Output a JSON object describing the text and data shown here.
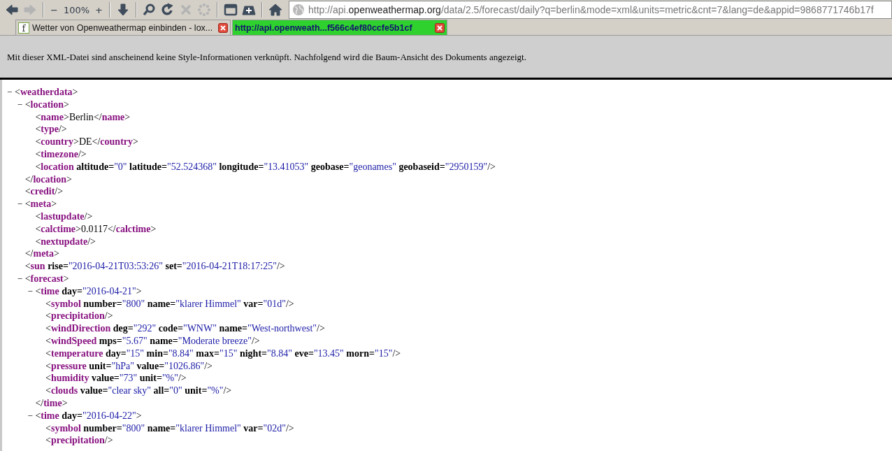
{
  "toolbar": [
    {
      "kind": "back",
      "disabled": false
    },
    {
      "kind": "forward",
      "disabled": true
    },
    {
      "kind": "separator"
    },
    {
      "kind": "zoom_out",
      "label": "−",
      "disabled": false
    },
    {
      "kind": "zoom_level",
      "label": "100%",
      "disabled": false
    },
    {
      "kind": "zoom_in",
      "label": "+",
      "disabled": false
    },
    {
      "kind": "separator"
    },
    {
      "kind": "download",
      "disabled": false
    },
    {
      "kind": "separator"
    },
    {
      "kind": "search",
      "disabled": false
    },
    {
      "kind": "reload",
      "disabled": false
    },
    {
      "kind": "stop",
      "disabled": true
    },
    {
      "kind": "spinner",
      "disabled": true
    },
    {
      "kind": "separator"
    },
    {
      "kind": "window",
      "disabled": false
    },
    {
      "kind": "new_tab",
      "disabled": false
    },
    {
      "kind": "separator"
    },
    {
      "kind": "home",
      "disabled": false
    }
  ],
  "address": {
    "prefix": "http://api.",
    "domain": "openweathermap.org",
    "path": "/data/2.5/forecast/daily?q=berlin&mode=xml&units=metric&cnt=7&lang=de&appid=9868771746b17f"
  },
  "tabs": [
    {
      "label": "Wetter von Openweathermap einbinden - lox...",
      "icon_letter": "f",
      "selected": false
    },
    {
      "label": "http://api.openweath...f566c4ef80ccfe5b1cf",
      "selected": true
    }
  ],
  "info_message": "Mit dieser XML-Datei sind anscheinend keine Style-Informationen verknüpft. Nachfolgend wird die Baum-Ansicht des Dokuments angezeigt.",
  "xml_tree": [
    {
      "toggle": "−",
      "open": [
        {
          "kind": "punct",
          "text": "<"
        },
        {
          "kind": "tag",
          "text": "weatherdata"
        },
        {
          "kind": "punct",
          "text": ">"
        }
      ],
      "children": [
        {
          "toggle": "−",
          "open": [
            {
              "kind": "punct",
              "text": "<"
            },
            {
              "kind": "tag",
              "text": "location"
            },
            {
              "kind": "punct",
              "text": ">"
            }
          ],
          "children": [
            {
              "open": [
                {
                  "kind": "punct",
                  "text": "<"
                },
                {
                  "kind": "tag",
                  "text": "name"
                },
                {
                  "kind": "punct",
                  "text": ">"
                },
                {
                  "kind": "text",
                  "text": "Berlin"
                },
                {
                  "kind": "punct",
                  "text": "</"
                },
                {
                  "kind": "tag",
                  "text": "name"
                },
                {
                  "kind": "punct",
                  "text": ">"
                }
              ]
            },
            {
              "open": [
                {
                  "kind": "punct",
                  "text": "<"
                },
                {
                  "kind": "tag",
                  "text": "type"
                },
                {
                  "kind": "punct",
                  "text": "/>"
                }
              ]
            },
            {
              "open": [
                {
                  "kind": "punct",
                  "text": "<"
                },
                {
                  "kind": "tag",
                  "text": "country"
                },
                {
                  "kind": "punct",
                  "text": ">"
                },
                {
                  "kind": "text",
                  "text": "DE"
                },
                {
                  "kind": "punct",
                  "text": "</"
                },
                {
                  "kind": "tag",
                  "text": "country"
                },
                {
                  "kind": "punct",
                  "text": ">"
                }
              ]
            },
            {
              "open": [
                {
                  "kind": "punct",
                  "text": "<"
                },
                {
                  "kind": "tag",
                  "text": "timezone"
                },
                {
                  "kind": "punct",
                  "text": "/>"
                }
              ]
            },
            {
              "open": [
                {
                  "kind": "punct",
                  "text": "<"
                },
                {
                  "kind": "tag",
                  "text": "location"
                },
                {
                  "kind": "attr",
                  "text": " altitude="
                },
                {
                  "kind": "value",
                  "text": "\"0\""
                },
                {
                  "kind": "attr",
                  "text": " latitude="
                },
                {
                  "kind": "value",
                  "text": "\"52.524368\""
                },
                {
                  "kind": "attr",
                  "text": " longitude="
                },
                {
                  "kind": "value",
                  "text": "\"13.41053\""
                },
                {
                  "kind": "attr",
                  "text": " geobase="
                },
                {
                  "kind": "value",
                  "text": "\"geonames\""
                },
                {
                  "kind": "attr",
                  "text": " geobaseid="
                },
                {
                  "kind": "value",
                  "text": "\"2950159\""
                },
                {
                  "kind": "punct",
                  "text": "/>"
                }
              ]
            }
          ],
          "close": [
            {
              "kind": "punct",
              "text": "</"
            },
            {
              "kind": "tag",
              "text": "location"
            },
            {
              "kind": "punct",
              "text": ">"
            }
          ]
        },
        {
          "open": [
            {
              "kind": "punct",
              "text": "<"
            },
            {
              "kind": "tag",
              "text": "credit"
            },
            {
              "kind": "punct",
              "text": "/>"
            }
          ]
        },
        {
          "toggle": "−",
          "open": [
            {
              "kind": "punct",
              "text": "<"
            },
            {
              "kind": "tag",
              "text": "meta"
            },
            {
              "kind": "punct",
              "text": ">"
            }
          ],
          "children": [
            {
              "open": [
                {
                  "kind": "punct",
                  "text": "<"
                },
                {
                  "kind": "tag",
                  "text": "lastupdate"
                },
                {
                  "kind": "punct",
                  "text": "/>"
                }
              ]
            },
            {
              "open": [
                {
                  "kind": "punct",
                  "text": "<"
                },
                {
                  "kind": "tag",
                  "text": "calctime"
                },
                {
                  "kind": "punct",
                  "text": ">"
                },
                {
                  "kind": "text",
                  "text": "0.0117"
                },
                {
                  "kind": "punct",
                  "text": "</"
                },
                {
                  "kind": "tag",
                  "text": "calctime"
                },
                {
                  "kind": "punct",
                  "text": ">"
                }
              ]
            },
            {
              "open": [
                {
                  "kind": "punct",
                  "text": "<"
                },
                {
                  "kind": "tag",
                  "text": "nextupdate"
                },
                {
                  "kind": "punct",
                  "text": "/>"
                }
              ]
            }
          ],
          "close": [
            {
              "kind": "punct",
              "text": "</"
            },
            {
              "kind": "tag",
              "text": "meta"
            },
            {
              "kind": "punct",
              "text": ">"
            }
          ]
        },
        {
          "open": [
            {
              "kind": "punct",
              "text": "<"
            },
            {
              "kind": "tag",
              "text": "sun"
            },
            {
              "kind": "attr",
              "text": " rise="
            },
            {
              "kind": "value",
              "text": "\"2016-04-21T03:53:26\""
            },
            {
              "kind": "attr",
              "text": " set="
            },
            {
              "kind": "value",
              "text": "\"2016-04-21T18:17:25\""
            },
            {
              "kind": "punct",
              "text": "/>"
            }
          ]
        },
        {
          "toggle": "−",
          "open": [
            {
              "kind": "punct",
              "text": "<"
            },
            {
              "kind": "tag",
              "text": "forecast"
            },
            {
              "kind": "punct",
              "text": ">"
            }
          ],
          "children": [
            {
              "toggle": "−",
              "open": [
                {
                  "kind": "punct",
                  "text": "<"
                },
                {
                  "kind": "tag",
                  "text": "time"
                },
                {
                  "kind": "attr",
                  "text": " day="
                },
                {
                  "kind": "value",
                  "text": "\"2016-04-21\""
                },
                {
                  "kind": "punct",
                  "text": ">"
                }
              ],
              "children": [
                {
                  "open": [
                    {
                      "kind": "punct",
                      "text": "<"
                    },
                    {
                      "kind": "tag",
                      "text": "symbol"
                    },
                    {
                      "kind": "attr",
                      "text": " number="
                    },
                    {
                      "kind": "value",
                      "text": "\"800\""
                    },
                    {
                      "kind": "attr",
                      "text": " name="
                    },
                    {
                      "kind": "value",
                      "text": "\"klarer Himmel\""
                    },
                    {
                      "kind": "attr",
                      "text": " var="
                    },
                    {
                      "kind": "value",
                      "text": "\"01d\""
                    },
                    {
                      "kind": "punct",
                      "text": "/>"
                    }
                  ]
                },
                {
                  "open": [
                    {
                      "kind": "punct",
                      "text": "<"
                    },
                    {
                      "kind": "tag",
                      "text": "precipitation"
                    },
                    {
                      "kind": "punct",
                      "text": "/>"
                    }
                  ]
                },
                {
                  "open": [
                    {
                      "kind": "punct",
                      "text": "<"
                    },
                    {
                      "kind": "tag",
                      "text": "windDirection"
                    },
                    {
                      "kind": "attr",
                      "text": " deg="
                    },
                    {
                      "kind": "value",
                      "text": "\"292\""
                    },
                    {
                      "kind": "attr",
                      "text": " code="
                    },
                    {
                      "kind": "value",
                      "text": "\"WNW\""
                    },
                    {
                      "kind": "attr",
                      "text": " name="
                    },
                    {
                      "kind": "value",
                      "text": "\"West-northwest\""
                    },
                    {
                      "kind": "punct",
                      "text": "/>"
                    }
                  ]
                },
                {
                  "open": [
                    {
                      "kind": "punct",
                      "text": "<"
                    },
                    {
                      "kind": "tag",
                      "text": "windSpeed"
                    },
                    {
                      "kind": "attr",
                      "text": " mps="
                    },
                    {
                      "kind": "value",
                      "text": "\"5.67\""
                    },
                    {
                      "kind": "attr",
                      "text": " name="
                    },
                    {
                      "kind": "value",
                      "text": "\"Moderate breeze\""
                    },
                    {
                      "kind": "punct",
                      "text": "/>"
                    }
                  ]
                },
                {
                  "open": [
                    {
                      "kind": "punct",
                      "text": "<"
                    },
                    {
                      "kind": "tag",
                      "text": "temperature"
                    },
                    {
                      "kind": "attr",
                      "text": " day="
                    },
                    {
                      "kind": "value",
                      "text": "\"15\""
                    },
                    {
                      "kind": "attr",
                      "text": " min="
                    },
                    {
                      "kind": "value",
                      "text": "\"8.84\""
                    },
                    {
                      "kind": "attr",
                      "text": " max="
                    },
                    {
                      "kind": "value",
                      "text": "\"15\""
                    },
                    {
                      "kind": "attr",
                      "text": " night="
                    },
                    {
                      "kind": "value",
                      "text": "\"8.84\""
                    },
                    {
                      "kind": "attr",
                      "text": " eve="
                    },
                    {
                      "kind": "value",
                      "text": "\"13.45\""
                    },
                    {
                      "kind": "attr",
                      "text": " morn="
                    },
                    {
                      "kind": "value",
                      "text": "\"15\""
                    },
                    {
                      "kind": "punct",
                      "text": "/>"
                    }
                  ]
                },
                {
                  "open": [
                    {
                      "kind": "punct",
                      "text": "<"
                    },
                    {
                      "kind": "tag",
                      "text": "pressure"
                    },
                    {
                      "kind": "attr",
                      "text": " unit="
                    },
                    {
                      "kind": "value",
                      "text": "\"hPa\""
                    },
                    {
                      "kind": "attr",
                      "text": " value="
                    },
                    {
                      "kind": "value",
                      "text": "\"1026.86\""
                    },
                    {
                      "kind": "punct",
                      "text": "/>"
                    }
                  ]
                },
                {
                  "open": [
                    {
                      "kind": "punct",
                      "text": "<"
                    },
                    {
                      "kind": "tag",
                      "text": "humidity"
                    },
                    {
                      "kind": "attr",
                      "text": " value="
                    },
                    {
                      "kind": "value",
                      "text": "\"73\""
                    },
                    {
                      "kind": "attr",
                      "text": " unit="
                    },
                    {
                      "kind": "value",
                      "text": "\"%\""
                    },
                    {
                      "kind": "punct",
                      "text": "/>"
                    }
                  ]
                },
                {
                  "open": [
                    {
                      "kind": "punct",
                      "text": "<"
                    },
                    {
                      "kind": "tag",
                      "text": "clouds"
                    },
                    {
                      "kind": "attr",
                      "text": " value="
                    },
                    {
                      "kind": "value",
                      "text": "\"clear sky\""
                    },
                    {
                      "kind": "attr",
                      "text": " all="
                    },
                    {
                      "kind": "value",
                      "text": "\"0\""
                    },
                    {
                      "kind": "attr",
                      "text": " unit="
                    },
                    {
                      "kind": "value",
                      "text": "\"%\""
                    },
                    {
                      "kind": "punct",
                      "text": "/>"
                    }
                  ]
                }
              ],
              "close": [
                {
                  "kind": "punct",
                  "text": "</"
                },
                {
                  "kind": "tag",
                  "text": "time"
                },
                {
                  "kind": "punct",
                  "text": ">"
                }
              ]
            },
            {
              "toggle": "−",
              "open": [
                {
                  "kind": "punct",
                  "text": "<"
                },
                {
                  "kind": "tag",
                  "text": "time"
                },
                {
                  "kind": "attr",
                  "text": " day="
                },
                {
                  "kind": "value",
                  "text": "\"2016-04-22\""
                },
                {
                  "kind": "punct",
                  "text": ">"
                }
              ],
              "children": [
                {
                  "open": [
                    {
                      "kind": "punct",
                      "text": "<"
                    },
                    {
                      "kind": "tag",
                      "text": "symbol"
                    },
                    {
                      "kind": "attr",
                      "text": " number="
                    },
                    {
                      "kind": "value",
                      "text": "\"800\""
                    },
                    {
                      "kind": "attr",
                      "text": " name="
                    },
                    {
                      "kind": "value",
                      "text": "\"klarer Himmel\""
                    },
                    {
                      "kind": "attr",
                      "text": " var="
                    },
                    {
                      "kind": "value",
                      "text": "\"02d\""
                    },
                    {
                      "kind": "punct",
                      "text": "/>"
                    }
                  ]
                },
                {
                  "open": [
                    {
                      "kind": "punct",
                      "text": "<"
                    },
                    {
                      "kind": "tag",
                      "text": "precipitation"
                    },
                    {
                      "kind": "punct",
                      "text": "/>"
                    }
                  ]
                }
              ]
            }
          ]
        }
      ]
    }
  ]
}
